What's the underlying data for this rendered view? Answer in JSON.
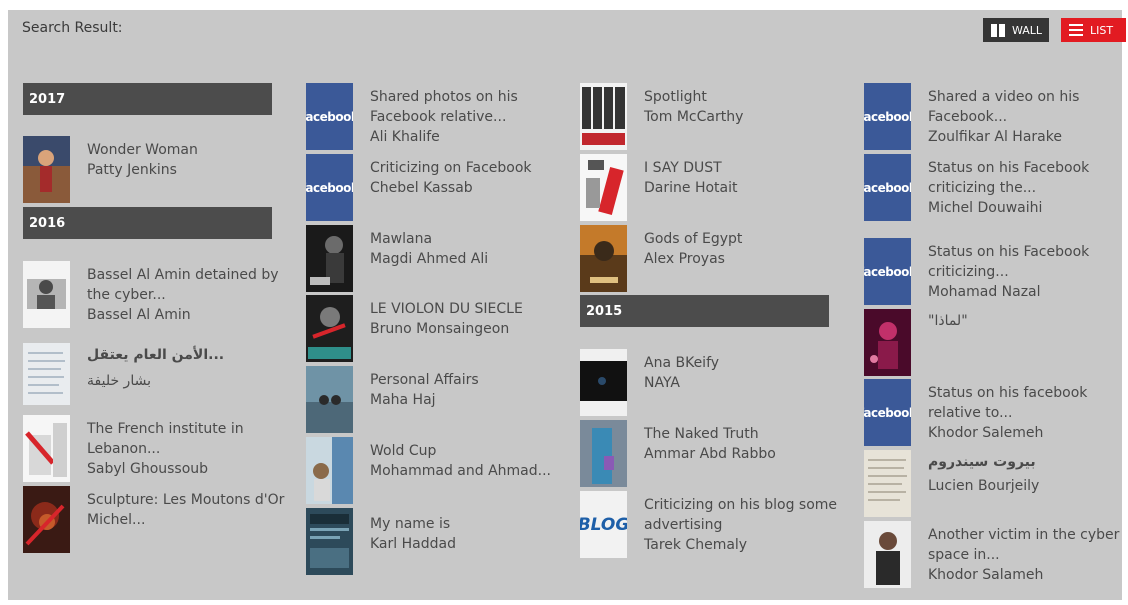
{
  "header": {
    "title": "Search Result:",
    "wall_label": "WALL",
    "list_label": "LIST"
  },
  "colors": {
    "header_bar": "#4c4c4c",
    "accent": "#e21b22",
    "panel": "#c8c8c8",
    "facebook": "#3b5998"
  },
  "columns": {
    "c1": {
      "h2017": "2017",
      "ww": {
        "title": "Wonder Woman",
        "sub": "Patty Jenkins"
      },
      "h2016": "2016",
      "bassel": {
        "title": "Bassel Al Amin detained by the cyber...",
        "sub": "Bassel Al Amin"
      },
      "amn": {
        "title": "...الأمن العام يعتقل",
        "sub": "بشار خليفة"
      },
      "french": {
        "title": "The French institute in Lebanon...",
        "sub": "Sabyl Ghoussoub"
      },
      "sculpt": {
        "title": "Sculpture: Les Moutons d'Or",
        "sub": "Michel..."
      }
    },
    "c2": {
      "a": {
        "title": "Shared photos on his Facebook relative...",
        "sub": "Ali Khalife",
        "icon": "facebook"
      },
      "b": {
        "title": "Criticizing on Facebook",
        "sub": "Chebel Kassab",
        "icon": "facebook"
      },
      "c": {
        "title": "Mawlana",
        "sub": "Magdi Ahmed Ali"
      },
      "d": {
        "title": "LE VIOLON DU SIECLE",
        "sub": "Bruno Monsaingeon"
      },
      "e": {
        "title": "Personal Affairs",
        "sub": "Maha Haj"
      },
      "f": {
        "title": "Wold Cup",
        "sub": "Mohammad and Ahmad..."
      },
      "g": {
        "title": "My name is",
        "sub": "Karl Haddad"
      }
    },
    "c3": {
      "a": {
        "title": "Spotlight",
        "sub": "Tom McCarthy"
      },
      "b": {
        "title": "I SAY DUST",
        "sub": "Darine Hotait"
      },
      "c": {
        "title": "Gods of Egypt",
        "sub": "Alex Proyas"
      },
      "h2015": "2015",
      "d": {
        "title": "Ana BKeify",
        "sub": "NAYA"
      },
      "e": {
        "title": "The Naked Truth",
        "sub": "Ammar Abd Rabbo"
      },
      "f": {
        "title": "Criticizing on his blog some advertising",
        "sub": "Tarek Chemaly",
        "icon": "BLOG"
      }
    },
    "c4": {
      "a": {
        "title": "Shared a video on his Facebook...",
        "sub": "Zoulfikar Al Harake",
        "icon": "facebook"
      },
      "b": {
        "title": "Status on his Facebook criticizing the...",
        "sub": "Michel Douwaihi",
        "icon": "facebook"
      },
      "c": {
        "title": "Status on his Facebook criticizing...",
        "sub": "Mohamad Nazal",
        "icon": "facebook"
      },
      "d": {
        "title": "\"لماذا\"",
        "sub": ""
      },
      "e": {
        "title": "Status on his facebook relative to...",
        "sub": "Khodor Salemeh",
        "icon": "facebook"
      },
      "f": {
        "title": "بيروت سيندروم",
        "sub": "Lucien Bourjeily"
      },
      "g": {
        "title": "Another victim in the cyber space in...",
        "sub": "Khodor Salameh"
      }
    }
  }
}
